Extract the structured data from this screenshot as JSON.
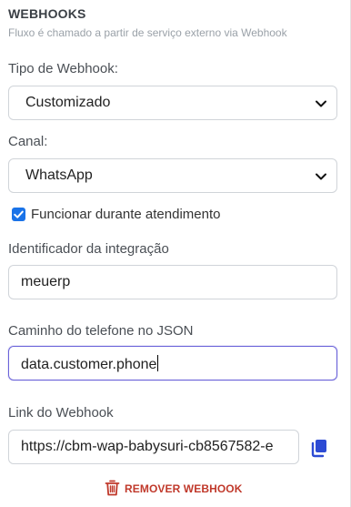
{
  "header": {
    "title": "WEBHOOKS",
    "subtitle": "Fluxo é chamado a partir de serviço externo via Webhook"
  },
  "webhook_type": {
    "label": "Tipo de Webhook:",
    "selected": "Customizado"
  },
  "channel": {
    "label": "Canal:",
    "selected": "WhatsApp"
  },
  "during_service": {
    "label": "Funcionar durante atendimento",
    "checked": true
  },
  "integration_id": {
    "label": "Identificador da integração",
    "value": "meuerp"
  },
  "phone_path": {
    "label": "Caminho do telefone no JSON",
    "value": "data.customer.phone"
  },
  "webhook_link": {
    "label": "Link do Webhook",
    "value": "https://cbm-wap-babysuri-cb8567582-e"
  },
  "remove_button": {
    "label": "REMOVER WEBHOOK"
  },
  "colors": {
    "accent": "#1a73e8",
    "focus_border": "#6b63d9",
    "danger": "#c0392b"
  },
  "icons": {
    "copy": "copy-icon",
    "trash": "trash-icon",
    "chevron": "chevron-down-icon",
    "check": "checkmark-icon"
  }
}
